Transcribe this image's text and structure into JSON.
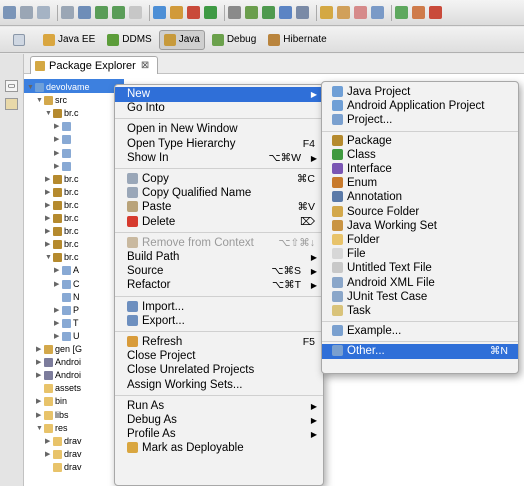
{
  "perspectives": [
    {
      "label": "Java EE",
      "icon": "java-ee-perspective-icon",
      "color": "#d9a640"
    },
    {
      "label": "DDMS",
      "icon": "ddms-perspective-icon",
      "color": "#5c9d3a"
    },
    {
      "label": "Java",
      "icon": "java-perspective-icon",
      "color": "#c79a3c"
    },
    {
      "label": "Debug",
      "icon": "debug-perspective-icon",
      "color": "#6ba14c"
    },
    {
      "label": "Hibernate",
      "icon": "hibernate-perspective-icon",
      "color": "#b9843d"
    }
  ],
  "explorer": {
    "tab_label": "Package Explorer",
    "close_glyph": "⊠",
    "tree": [
      {
        "label": "devolvame",
        "icon": "project-icon",
        "color": "#6fa0d9",
        "indent": 0,
        "twisty": "▼"
      },
      {
        "label": "src",
        "icon": "source-folder-icon",
        "color": "#d3a84b",
        "indent": 1,
        "twisty": "▼"
      },
      {
        "label": "br.c",
        "icon": "package-icon",
        "color": "#b58a2e",
        "indent": 2,
        "twisty": "▼"
      },
      {
        "label": "",
        "icon": "java-file-icon",
        "color": "#88a9d4",
        "indent": 3,
        "twisty": "▶"
      },
      {
        "label": "",
        "icon": "java-file-icon",
        "color": "#88a9d4",
        "indent": 3,
        "twisty": "▶"
      },
      {
        "label": "",
        "icon": "java-file-icon",
        "color": "#88a9d4",
        "indent": 3,
        "twisty": "▶"
      },
      {
        "label": "",
        "icon": "java-file-icon",
        "color": "#88a9d4",
        "indent": 3,
        "twisty": "▶"
      },
      {
        "label": "br.c",
        "icon": "package-icon",
        "color": "#b58a2e",
        "indent": 2,
        "twisty": "▶"
      },
      {
        "label": "br.c",
        "icon": "package-icon",
        "color": "#b58a2e",
        "indent": 2,
        "twisty": "▶"
      },
      {
        "label": "br.c",
        "icon": "package-icon",
        "color": "#b58a2e",
        "indent": 2,
        "twisty": "▶"
      },
      {
        "label": "br.c",
        "icon": "package-icon",
        "color": "#b58a2e",
        "indent": 2,
        "twisty": "▶"
      },
      {
        "label": "br.c",
        "icon": "package-icon",
        "color": "#b58a2e",
        "indent": 2,
        "twisty": "▶"
      },
      {
        "label": "br.c",
        "icon": "package-icon",
        "color": "#b58a2e",
        "indent": 2,
        "twisty": "▶"
      },
      {
        "label": "br.c",
        "icon": "package-icon",
        "color": "#b58a2e",
        "indent": 2,
        "twisty": "▼"
      },
      {
        "label": "A",
        "icon": "java-file-icon",
        "color": "#88a9d4",
        "indent": 3,
        "twisty": "▶"
      },
      {
        "label": "C",
        "icon": "java-file-icon",
        "color": "#88a9d4",
        "indent": 3,
        "twisty": "▶"
      },
      {
        "label": "N",
        "icon": "java-file-icon",
        "color": "#88a9d4",
        "indent": 3,
        "twisty": ""
      },
      {
        "label": "P",
        "icon": "java-file-icon",
        "color": "#88a9d4",
        "indent": 3,
        "twisty": "▶"
      },
      {
        "label": "T",
        "icon": "java-file-icon",
        "color": "#88a9d4",
        "indent": 3,
        "twisty": "▶"
      },
      {
        "label": "U",
        "icon": "java-file-icon",
        "color": "#88a9d4",
        "indent": 3,
        "twisty": "▶"
      },
      {
        "label": "gen [G",
        "icon": "source-folder-icon",
        "color": "#d3a84b",
        "indent": 1,
        "twisty": "▶"
      },
      {
        "label": "Androi",
        "icon": "library-icon",
        "color": "#7c7c9c",
        "indent": 1,
        "twisty": "▶"
      },
      {
        "label": "Androi",
        "icon": "library-icon",
        "color": "#7c7c9c",
        "indent": 1,
        "twisty": "▶"
      },
      {
        "label": "assets",
        "icon": "folder-icon",
        "color": "#e8c36a",
        "indent": 1,
        "twisty": ""
      },
      {
        "label": "bin",
        "icon": "folder-icon",
        "color": "#e8c36a",
        "indent": 1,
        "twisty": "▶"
      },
      {
        "label": "libs",
        "icon": "folder-icon",
        "color": "#e8c36a",
        "indent": 1,
        "twisty": "▶"
      },
      {
        "label": "res",
        "icon": "folder-icon",
        "color": "#e8c36a",
        "indent": 1,
        "twisty": "▼"
      },
      {
        "label": "drav",
        "icon": "folder-icon",
        "color": "#e8c36a",
        "indent": 2,
        "twisty": "▶"
      },
      {
        "label": "drav",
        "icon": "folder-icon",
        "color": "#e8c36a",
        "indent": 2,
        "twisty": "▶"
      },
      {
        "label": "drav",
        "icon": "folder-icon",
        "color": "#e8c36a",
        "indent": 2,
        "twisty": ""
      }
    ]
  },
  "context_menu": {
    "items": [
      {
        "label": "New",
        "type": "item",
        "submenu": true,
        "highlight": true,
        "icon": "",
        "shortcut": ""
      },
      {
        "label": "Go Into",
        "type": "item",
        "submenu": false,
        "icon": "",
        "shortcut": ""
      },
      {
        "type": "sep"
      },
      {
        "label": "Open in New Window",
        "type": "item",
        "submenu": false,
        "icon": "",
        "shortcut": ""
      },
      {
        "label": "Open Type Hierarchy",
        "type": "item",
        "submenu": false,
        "icon": "",
        "shortcut": "F4"
      },
      {
        "label": "Show In",
        "type": "item",
        "submenu": true,
        "icon": "",
        "shortcut": "⌥⌘W"
      },
      {
        "type": "sep"
      },
      {
        "label": "Copy",
        "type": "item",
        "submenu": false,
        "icon": "copy-icon",
        "icon_color": "#9aa7b8",
        "shortcut": "⌘C"
      },
      {
        "label": "Copy Qualified Name",
        "type": "item",
        "submenu": false,
        "icon": "copy-qualified-name-icon",
        "icon_color": "#9aa7b8",
        "shortcut": ""
      },
      {
        "label": "Paste",
        "type": "item",
        "submenu": false,
        "icon": "paste-icon",
        "icon_color": "#b9a37a",
        "shortcut": "⌘V"
      },
      {
        "label": "Delete",
        "type": "item",
        "submenu": false,
        "icon": "delete-icon",
        "icon_color": "#d63a2e",
        "shortcut": "⌦"
      },
      {
        "type": "sep"
      },
      {
        "label": "Remove from Context",
        "type": "item",
        "submenu": false,
        "disabled": true,
        "icon": "remove-from-context-icon",
        "icon_color": "#c9b9a0",
        "shortcut": "⌥⇧⌘↓"
      },
      {
        "label": "Build Path",
        "type": "item",
        "submenu": true,
        "icon": "",
        "shortcut": ""
      },
      {
        "label": "Source",
        "type": "item",
        "submenu": true,
        "icon": "",
        "shortcut": "⌥⌘S"
      },
      {
        "label": "Refactor",
        "type": "item",
        "submenu": true,
        "icon": "",
        "shortcut": "⌥⌘T"
      },
      {
        "type": "sep"
      },
      {
        "label": "Import...",
        "type": "item",
        "submenu": false,
        "icon": "import-icon",
        "icon_color": "#6d8fbf",
        "shortcut": ""
      },
      {
        "label": "Export...",
        "type": "item",
        "submenu": false,
        "icon": "export-icon",
        "icon_color": "#6d8fbf",
        "shortcut": ""
      },
      {
        "type": "sep"
      },
      {
        "label": "Refresh",
        "type": "item",
        "submenu": false,
        "icon": "refresh-icon",
        "icon_color": "#d89b3a",
        "shortcut": "F5"
      },
      {
        "label": "Close Project",
        "type": "item",
        "submenu": false,
        "icon": "",
        "shortcut": ""
      },
      {
        "label": "Close Unrelated Projects",
        "type": "item",
        "submenu": false,
        "icon": "",
        "shortcut": ""
      },
      {
        "label": "Assign Working Sets...",
        "type": "item",
        "submenu": false,
        "icon": "",
        "shortcut": ""
      },
      {
        "type": "sep"
      },
      {
        "label": "Run As",
        "type": "item",
        "submenu": true,
        "icon": "",
        "shortcut": ""
      },
      {
        "label": "Debug As",
        "type": "item",
        "submenu": true,
        "icon": "",
        "shortcut": ""
      },
      {
        "label": "Profile As",
        "type": "item",
        "submenu": true,
        "icon": "",
        "shortcut": ""
      },
      {
        "label": "Mark as Deployable",
        "type": "item",
        "submenu": false,
        "icon": "mark-deployable-icon",
        "icon_color": "#d9a640",
        "shortcut": ""
      }
    ]
  },
  "new_submenu": {
    "items": [
      {
        "label": "Java Project",
        "icon": "java-project-icon",
        "icon_color": "#6f9fd6",
        "type": "item"
      },
      {
        "label": "Android Application Project",
        "icon": "android-project-icon",
        "icon_color": "#6f9fd6",
        "type": "item"
      },
      {
        "label": "Project...",
        "icon": "project-wizard-icon",
        "icon_color": "#7aa0cf",
        "type": "item"
      },
      {
        "type": "sep"
      },
      {
        "label": "Package",
        "icon": "package-icon",
        "icon_color": "#b58a2e",
        "type": "item"
      },
      {
        "label": "Class",
        "icon": "class-icon",
        "icon_color": "#3f9a3f",
        "type": "item"
      },
      {
        "label": "Interface",
        "icon": "interface-icon",
        "icon_color": "#7a55b3",
        "type": "item"
      },
      {
        "label": "Enum",
        "icon": "enum-icon",
        "icon_color": "#c87a2c",
        "type": "item"
      },
      {
        "label": "Annotation",
        "icon": "annotation-icon",
        "icon_color": "#5b7aa8",
        "type": "item"
      },
      {
        "label": "Source Folder",
        "icon": "source-folder-icon",
        "icon_color": "#d3a84b",
        "type": "item"
      },
      {
        "label": "Java Working Set",
        "icon": "working-set-icon",
        "icon_color": "#c99443",
        "type": "item"
      },
      {
        "label": "Folder",
        "icon": "folder-icon",
        "icon_color": "#e8c36a",
        "type": "item"
      },
      {
        "label": "File",
        "icon": "file-icon",
        "icon_color": "#d7d7d7",
        "type": "item"
      },
      {
        "label": "Untitled Text File",
        "icon": "text-file-icon",
        "icon_color": "#c8c8c8",
        "type": "item"
      },
      {
        "label": "Android XML File",
        "icon": "android-xml-icon",
        "icon_color": "#8aa6c9",
        "type": "item"
      },
      {
        "label": "JUnit Test Case",
        "icon": "junit-icon",
        "icon_color": "#8aa6c9",
        "type": "item"
      },
      {
        "label": "Task",
        "icon": "task-icon",
        "icon_color": "#d9c37a",
        "type": "item"
      },
      {
        "type": "sep"
      },
      {
        "label": "Example...",
        "icon": "example-icon",
        "icon_color": "#7aa0cf",
        "type": "item"
      },
      {
        "type": "sep"
      },
      {
        "label": "Other...",
        "icon": "other-wizard-icon",
        "icon_color": "#7aa0cf",
        "type": "item",
        "highlight": true,
        "shortcut": "⌘N"
      }
    ]
  }
}
